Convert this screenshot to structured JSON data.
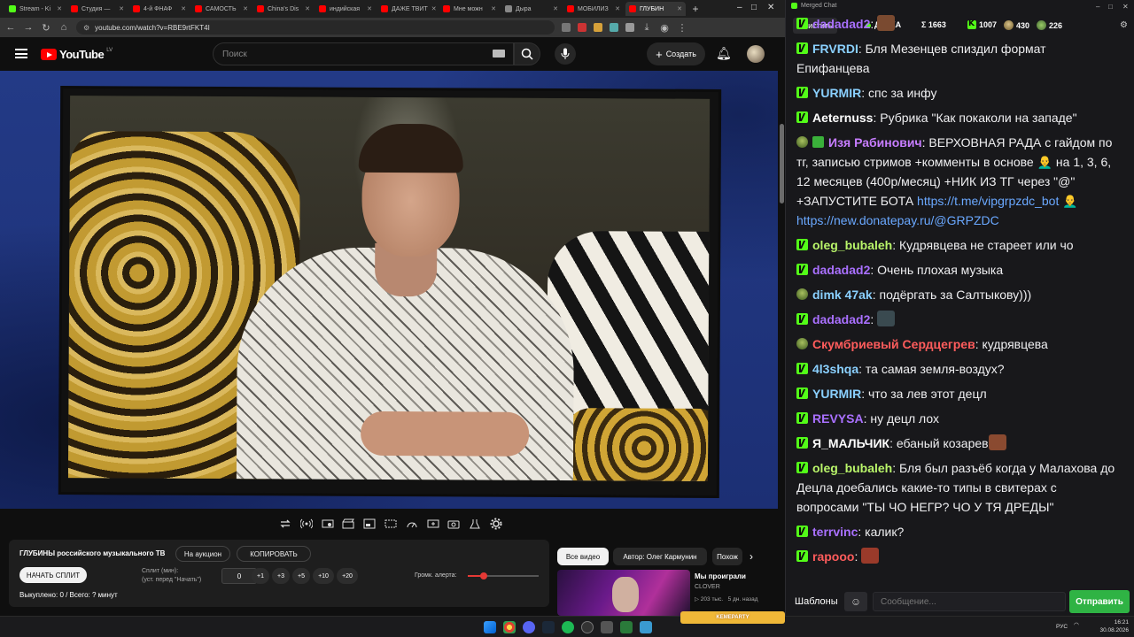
{
  "browser": {
    "tabs": [
      {
        "label": "Stream - Ki",
        "color": "#53fc18"
      },
      {
        "label": "Студия —",
        "color": "#ff0000"
      },
      {
        "label": "4-й ФНАФ",
        "color": "#ff0000"
      },
      {
        "label": "САМОСТЬ",
        "color": "#ff0000"
      },
      {
        "label": "China's Dis",
        "color": "#ff0000"
      },
      {
        "label": "индийская",
        "color": "#ff0000"
      },
      {
        "label": "ДАЖЕ ТВИТ",
        "color": "#ff0000"
      },
      {
        "label": "Мне можн",
        "color": "#ff0000"
      },
      {
        "label": "Дыра",
        "color": "#888888"
      },
      {
        "label": "МОБИЛИЗ",
        "color": "#ff0000"
      },
      {
        "label": "ГЛУБИН",
        "color": "#ff0000",
        "active": true
      }
    ],
    "new_tab": "+",
    "url": "youtube.com/watch?v=RBE9rtFKT4I"
  },
  "youtube": {
    "logo_text": "YouTube",
    "country_code": "LV",
    "search_placeholder": "Поиск",
    "create_label": "Создать"
  },
  "split_panel": {
    "title": "ГЛУБИНЫ российского музыкального ТВ",
    "auction_label": "На аукцион",
    "copy_label": "КОПИРОВАТЬ",
    "start_split_label": "НАЧАТЬ СПЛИТ",
    "split_min_label": "Сплит (мин):",
    "split_hint": "(уст. перед \"Начать\")",
    "split_value": "0",
    "increments": [
      "+1",
      "+3",
      "+5",
      "+10",
      "+20"
    ],
    "volume_label": "Громк. алерта:",
    "volume_level": 0.22,
    "paid_label": "Выкуплено: 0 / Всего: ? минут"
  },
  "recommendations": {
    "chips": [
      {
        "label": "Все видео",
        "active": true
      },
      {
        "label": "Автор: Олег Кармунин",
        "active": false
      },
      {
        "label": "Похож",
        "active": false
      }
    ],
    "video": {
      "title": "Мы проиграли",
      "channel": "CLOVER",
      "views": "▷ 203 тыс.",
      "age": "5 дн. назад"
    }
  },
  "chat": {
    "window_title": "Merged Chat",
    "clear_label": "Очистить",
    "channel_name": "ДУРКА",
    "stats": {
      "sigma": "Σ 1663",
      "kick": "1007",
      "pepe": "430",
      "other": "226"
    },
    "messages": [
      {
        "badges": [
          "k"
        ],
        "name": "dadadad2",
        "color": "#a970ff",
        "text": "",
        "emote": "#7a4a30"
      },
      {
        "badges": [
          "k"
        ],
        "name": "FRVRDI",
        "color": "#8ad0ff",
        "text": "Бля Мезенцев спиздил формат Епифанцева"
      },
      {
        "badges": [
          "k"
        ],
        "name": "YURMIR",
        "color": "#8ad0ff",
        "text": "спс за инфу"
      },
      {
        "badges": [
          "k"
        ],
        "name": "Aeternuss",
        "color": "#ffffff",
        "text": "Рубрика \"Как покаколи на западе\""
      },
      {
        "badges": [
          "pepe",
          "edit"
        ],
        "name": "Изя Рабинович",
        "color": "#c77dff",
        "text": "ВЕРХОВНАЯ РАДА с гайдом по тг, записью стримов +комменты в основе 👨‍🦲 на 1, 3, 6, 12 месяцев (400р/месяц) +НИК ИЗ ТГ через \"@\" +ЗАПУСТИТЕ БОТА ",
        "link1": "https://t.me/vipgrpzdc_bot",
        "mid": " 👨‍🦲 ",
        "link2": "https://new.donatepay.ru/@GRPZDC"
      },
      {
        "badges": [
          "k"
        ],
        "name": "oleg_bubaleh",
        "color": "#b9f56a",
        "text": "Кудрявцева не стареет или чо"
      },
      {
        "badges": [
          "k"
        ],
        "name": "dadadad2",
        "color": "#a970ff",
        "text": "Очень плохая музыка"
      },
      {
        "badges": [
          "pepe"
        ],
        "name": "dimk 47ak",
        "color": "#8ad0ff",
        "text": "подёргать за Салтыкову)))"
      },
      {
        "badges": [
          "k"
        ],
        "name": "dadadad2",
        "color": "#a970ff",
        "text": "",
        "emote": "#3a4a50"
      },
      {
        "badges": [
          "pepe"
        ],
        "name": "Скумбриевый Сердцегрев",
        "color": "#ff5c5c",
        "text": "кудрявцева"
      },
      {
        "badges": [
          "k"
        ],
        "name": "4l3shqa",
        "color": "#8ad0ff",
        "text": "та самая земля-воздух?"
      },
      {
        "badges": [
          "k"
        ],
        "name": "YURMIR",
        "color": "#8ad0ff",
        "text": "что за лев этот децл"
      },
      {
        "badges": [
          "k"
        ],
        "name": "REVYSA",
        "color": "#a970ff",
        "text": "ну децл лох"
      },
      {
        "badges": [
          "k"
        ],
        "name": "Я_МАЛЬЧИК",
        "color": "#ffffff",
        "text": "ебаный козарев",
        "emote": "#8a4a30"
      },
      {
        "badges": [
          "k"
        ],
        "name": "oleg_bubaleh",
        "color": "#b9f56a",
        "text": "Бля был разъёб когда у Малахова до Децла доебались какие-то типы в свитерах с вопросами \"ТЫ ЧО НЕГР? ЧО У ТЯ ДРЕДЫ\""
      },
      {
        "badges": [
          "k"
        ],
        "name": "terrvinc",
        "color": "#a970ff",
        "text": "калик?"
      },
      {
        "badges": [
          "k"
        ],
        "name": "rapooo",
        "color": "#ff5c5c",
        "text": "",
        "emote": "#9a3a2a"
      }
    ],
    "templates_label": "Шаблоны",
    "message_placeholder": "Сообщение...",
    "send_label": "Отправить"
  },
  "taskbar": {
    "promo": "KEMEPARTY",
    "lang": "РУС",
    "time": "16:21",
    "date": "30.08.2026"
  }
}
